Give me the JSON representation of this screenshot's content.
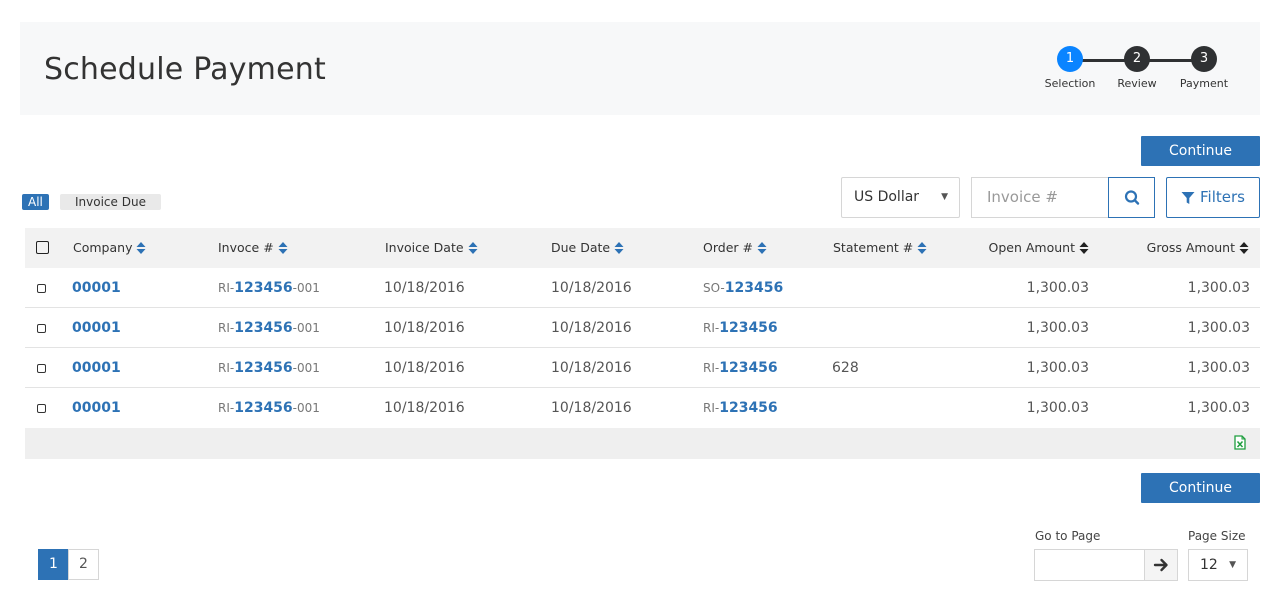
{
  "header": {
    "title": "Schedule Payment",
    "steps": [
      {
        "number": "1",
        "label": "Selection",
        "active": true
      },
      {
        "number": "2",
        "label": "Review",
        "active": false
      },
      {
        "number": "3",
        "label": "Payment",
        "active": false
      }
    ]
  },
  "toolbar": {
    "continue_label": "Continue",
    "filter_pills": [
      "All",
      "Invoice Due"
    ],
    "currency": "US Dollar",
    "search_placeholder": "Invoice #",
    "filters_label": "Filters"
  },
  "table": {
    "columns": [
      "Company",
      "Invoce #",
      "Invoice Date",
      "Due Date",
      "Order #",
      "Statement #",
      "Open Amount",
      "Gross Amount"
    ],
    "rows": [
      {
        "company": "00001",
        "invoice_prefix": "RI-",
        "invoice_num": "123456",
        "invoice_suffix": "-001",
        "invoice_date": "10/18/2016",
        "due_date": "10/18/2016",
        "order_prefix": "SO-",
        "order_num": "123456",
        "statement": "",
        "open_amount": "1,300.03",
        "gross_amount": "1,300.03"
      },
      {
        "company": "00001",
        "invoice_prefix": "RI-",
        "invoice_num": "123456",
        "invoice_suffix": "-001",
        "invoice_date": "10/18/2016",
        "due_date": "10/18/2016",
        "order_prefix": "RI-",
        "order_num": "123456",
        "statement": "",
        "open_amount": "1,300.03",
        "gross_amount": "1,300.03"
      },
      {
        "company": "00001",
        "invoice_prefix": "RI-",
        "invoice_num": "123456",
        "invoice_suffix": "-001",
        "invoice_date": "10/18/2016",
        "due_date": "10/18/2016",
        "order_prefix": "RI-",
        "order_num": "123456",
        "statement": "628",
        "open_amount": "1,300.03",
        "gross_amount": "1,300.03"
      },
      {
        "company": "00001",
        "invoice_prefix": "RI-",
        "invoice_num": "123456",
        "invoice_suffix": "-001",
        "invoice_date": "10/18/2016",
        "due_date": "10/18/2016",
        "order_prefix": "RI-",
        "order_num": "123456",
        "statement": "",
        "open_amount": "1,300.03",
        "gross_amount": "1,300.03"
      }
    ],
    "export_icon": "excel-export-icon"
  },
  "pagination": {
    "pages": [
      "1",
      "2"
    ],
    "current_page": "1",
    "goto_label": "Go to Page",
    "goto_value": "",
    "size_label": "Page Size",
    "page_size": "12"
  },
  "colors": {
    "primary": "#2d72b5",
    "step_active": "#0a84ff",
    "step_inactive": "#2f3133",
    "excel_green": "#1e9e3e"
  }
}
